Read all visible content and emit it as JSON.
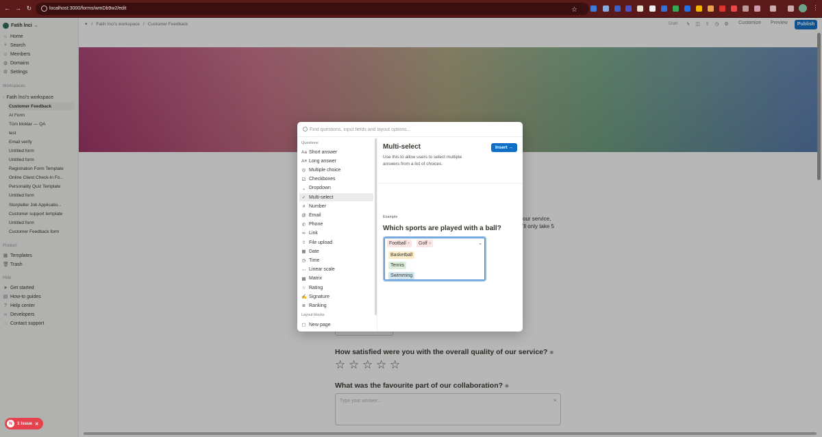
{
  "browser": {
    "url": "localhost:3000/forms/wmDb9w2/edit"
  },
  "sidebar": {
    "workspace_name": "Fatih İnci",
    "nav": [
      {
        "label": "Home",
        "icon": "home-icon"
      },
      {
        "label": "Search",
        "icon": "search-icon"
      },
      {
        "label": "Members",
        "icon": "members-icon"
      },
      {
        "label": "Domains",
        "icon": "globe-icon"
      },
      {
        "label": "Settings",
        "icon": "gear-icon"
      }
    ],
    "workspaces_header": "Workspaces",
    "workspace_tree_label": "Fatih İnci's workspace",
    "forms": [
      "Customer Feedback",
      "AI Form",
      "Tüm bloklar — QA",
      "test",
      "Email verify",
      "Untitled form",
      "Untitled form",
      "Registration Form Template",
      "Online Client Check-In Fo...",
      "Personality Quiz Template",
      "Untitled form",
      "Storyteller Job Applicatio...",
      "Customer support template",
      "Untitled form",
      "Customer Feedback form"
    ],
    "product_header": "Product",
    "product_items": [
      {
        "label": "Templates",
        "icon": "templates-icon"
      },
      {
        "label": "Trash",
        "icon": "trash-icon"
      }
    ],
    "help_header": "Help",
    "help_items": [
      {
        "label": "Get started",
        "icon": "send-icon"
      },
      {
        "label": "How-to guides",
        "icon": "book-icon"
      },
      {
        "label": "Help center",
        "icon": "help-icon"
      },
      {
        "label": "Developers",
        "icon": "code-icon"
      },
      {
        "label": "Contact support",
        "icon": "chat-icon"
      }
    ]
  },
  "topbar": {
    "breadcrumb": [
      "Fatih İnci's workspace",
      "Customer Feedback"
    ],
    "status": "Draft",
    "customize": "Customize",
    "preview": "Preview",
    "publish": "Publish"
  },
  "page": {
    "desc_fragment_1": "our service,",
    "desc_fragment_2": "'ll only take 5",
    "question_1": "How satisfied were you with the overall quality of our service?",
    "question_2": "What was the favourite part of our collaboration?",
    "answer_placeholder": "Type your answer...",
    "star_count": 5
  },
  "modal": {
    "search_placeholder": "Find questions, input fields and layout options...",
    "questions_header": "Questions",
    "items": [
      {
        "label": "Short answer",
        "icon": "short-answer-icon",
        "glyph": "Aa"
      },
      {
        "label": "Long answer",
        "icon": "long-answer-icon",
        "glyph": "A≡"
      },
      {
        "label": "Multiple choice",
        "icon": "multiple-choice-icon",
        "glyph": "◎"
      },
      {
        "label": "Checkboxes",
        "icon": "checkbox-icon",
        "glyph": "☑"
      },
      {
        "label": "Dropdown",
        "icon": "dropdown-icon",
        "glyph": "⌄"
      },
      {
        "label": "Multi-select",
        "icon": "multi-select-icon",
        "glyph": "✓",
        "active": true
      },
      {
        "label": "Number",
        "icon": "number-icon",
        "glyph": "#"
      },
      {
        "label": "Email",
        "icon": "email-icon",
        "glyph": "@"
      },
      {
        "label": "Phone",
        "icon": "phone-icon",
        "glyph": "✆"
      },
      {
        "label": "Link",
        "icon": "link-icon",
        "glyph": "∞"
      },
      {
        "label": "File upload",
        "icon": "upload-icon",
        "glyph": "⇧"
      },
      {
        "label": "Date",
        "icon": "calendar-icon",
        "glyph": "▦"
      },
      {
        "label": "Time",
        "icon": "clock-icon",
        "glyph": "◷"
      },
      {
        "label": "Linear scale",
        "icon": "linear-scale-icon",
        "glyph": "⋯"
      },
      {
        "label": "Matrix",
        "icon": "matrix-icon",
        "glyph": "▩"
      },
      {
        "label": "Rating",
        "icon": "star-icon",
        "glyph": "☆"
      },
      {
        "label": "Signature",
        "icon": "signature-icon",
        "glyph": "✍"
      },
      {
        "label": "Ranking",
        "icon": "ranking-icon",
        "glyph": "≣"
      }
    ],
    "layout_header": "Layout blocks",
    "layout_items": [
      {
        "label": "New page",
        "icon": "page-icon",
        "glyph": "▢"
      }
    ],
    "detail": {
      "title": "Multi-select",
      "description": "Use this to allow users to select multiple answers from a list of choices.",
      "insert_label": "Insert",
      "example_label": "Example",
      "example_question": "Which sports are played with a ball?",
      "selected": [
        {
          "label": "Football",
          "color": "#fbe4e4"
        },
        {
          "label": "Golf",
          "color": "#fbe4e4"
        }
      ],
      "options": [
        {
          "label": "Basketball",
          "color": "#fdecc8"
        },
        {
          "label": "Tennis",
          "color": "#dbeddb"
        },
        {
          "label": "Swimming",
          "color": "#d3e5ef"
        }
      ]
    }
  },
  "issue_badge": {
    "letter": "N",
    "label": "1 Issue"
  },
  "colors": {
    "accent": "#0f6fc6",
    "issue": "#e5424d"
  }
}
